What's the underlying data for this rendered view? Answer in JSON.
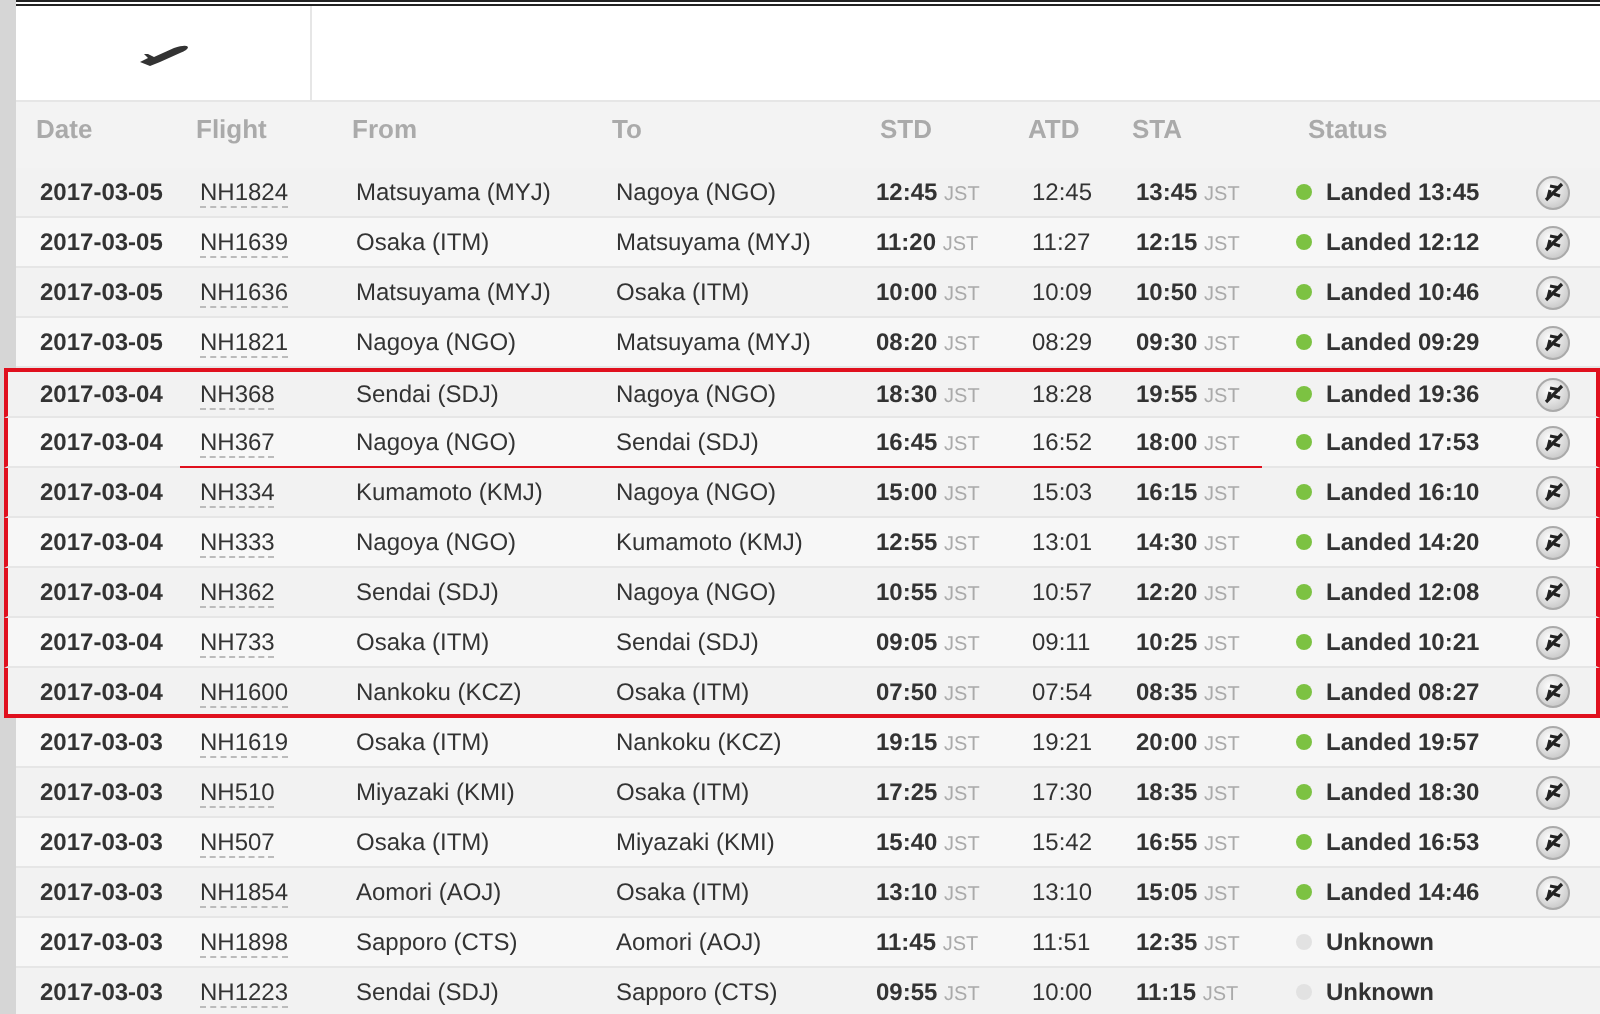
{
  "columns": [
    "Date",
    "Flight",
    "From",
    "To",
    "STD",
    "ATD",
    "STA",
    "Status"
  ],
  "rows": [
    {
      "date": "2017-03-05",
      "flight": "NH1824",
      "from": "Matsuyama (MYJ)",
      "to": "Nagoya (NGO)",
      "std": "12:45",
      "std_tz": "JST",
      "atd": "12:45",
      "sta": "13:45",
      "sta_tz": "JST",
      "status": "Landed 13:45",
      "color": "#7cc242",
      "tracking": true,
      "highlighted": false,
      "underlined": false
    },
    {
      "date": "2017-03-05",
      "flight": "NH1639",
      "from": "Osaka (ITM)",
      "to": "Matsuyama (MYJ)",
      "std": "11:20",
      "std_tz": "JST",
      "atd": "11:27",
      "sta": "12:15",
      "sta_tz": "JST",
      "status": "Landed 12:12",
      "color": "#7cc242",
      "tracking": true,
      "highlighted": false,
      "underlined": false
    },
    {
      "date": "2017-03-05",
      "flight": "NH1636",
      "from": "Matsuyama (MYJ)",
      "to": "Osaka (ITM)",
      "std": "10:00",
      "std_tz": "JST",
      "atd": "10:09",
      "sta": "10:50",
      "sta_tz": "JST",
      "status": "Landed 10:46",
      "color": "#7cc242",
      "tracking": true,
      "highlighted": false,
      "underlined": false
    },
    {
      "date": "2017-03-05",
      "flight": "NH1821",
      "from": "Nagoya (NGO)",
      "to": "Matsuyama (MYJ)",
      "std": "08:20",
      "std_tz": "JST",
      "atd": "08:29",
      "sta": "09:30",
      "sta_tz": "JST",
      "status": "Landed 09:29",
      "color": "#7cc242",
      "tracking": true,
      "highlighted": false,
      "underlined": false
    },
    {
      "date": "2017-03-04",
      "flight": "NH368",
      "from": "Sendai (SDJ)",
      "to": "Nagoya (NGO)",
      "std": "18:30",
      "std_tz": "JST",
      "atd": "18:28",
      "sta": "19:55",
      "sta_tz": "JST",
      "status": "Landed 19:36",
      "color": "#7cc242",
      "tracking": true,
      "highlighted": true,
      "underlined": false
    },
    {
      "date": "2017-03-04",
      "flight": "NH367",
      "from": "Nagoya (NGO)",
      "to": "Sendai (SDJ)",
      "std": "16:45",
      "std_tz": "JST",
      "atd": "16:52",
      "sta": "18:00",
      "sta_tz": "JST",
      "status": "Landed 17:53",
      "color": "#7cc242",
      "tracking": true,
      "highlighted": true,
      "underlined": true
    },
    {
      "date": "2017-03-04",
      "flight": "NH334",
      "from": "Kumamoto (KMJ)",
      "to": "Nagoya (NGO)",
      "std": "15:00",
      "std_tz": "JST",
      "atd": "15:03",
      "sta": "16:15",
      "sta_tz": "JST",
      "status": "Landed 16:10",
      "color": "#7cc242",
      "tracking": true,
      "highlighted": true,
      "underlined": false
    },
    {
      "date": "2017-03-04",
      "flight": "NH333",
      "from": "Nagoya (NGO)",
      "to": "Kumamoto (KMJ)",
      "std": "12:55",
      "std_tz": "JST",
      "atd": "13:01",
      "sta": "14:30",
      "sta_tz": "JST",
      "status": "Landed 14:20",
      "color": "#7cc242",
      "tracking": true,
      "highlighted": true,
      "underlined": false
    },
    {
      "date": "2017-03-04",
      "flight": "NH362",
      "from": "Sendai (SDJ)",
      "to": "Nagoya (NGO)",
      "std": "10:55",
      "std_tz": "JST",
      "atd": "10:57",
      "sta": "12:20",
      "sta_tz": "JST",
      "status": "Landed 12:08",
      "color": "#7cc242",
      "tracking": true,
      "highlighted": true,
      "underlined": false
    },
    {
      "date": "2017-03-04",
      "flight": "NH733",
      "from": "Osaka (ITM)",
      "to": "Sendai (SDJ)",
      "std": "09:05",
      "std_tz": "JST",
      "atd": "09:11",
      "sta": "10:25",
      "sta_tz": "JST",
      "status": "Landed 10:21",
      "color": "#7cc242",
      "tracking": true,
      "highlighted": true,
      "underlined": false
    },
    {
      "date": "2017-03-04",
      "flight": "NH1600",
      "from": "Nankoku (KCZ)",
      "to": "Osaka (ITM)",
      "std": "07:50",
      "std_tz": "JST",
      "atd": "07:54",
      "sta": "08:35",
      "sta_tz": "JST",
      "status": "Landed 08:27",
      "color": "#7cc242",
      "tracking": true,
      "highlighted": true,
      "underlined": false
    },
    {
      "date": "2017-03-03",
      "flight": "NH1619",
      "from": "Osaka (ITM)",
      "to": "Nankoku (KCZ)",
      "std": "19:15",
      "std_tz": "JST",
      "atd": "19:21",
      "sta": "20:00",
      "sta_tz": "JST",
      "status": "Landed 19:57",
      "color": "#7cc242",
      "tracking": true,
      "highlighted": false,
      "underlined": false
    },
    {
      "date": "2017-03-03",
      "flight": "NH510",
      "from": "Miyazaki (KMI)",
      "to": "Osaka (ITM)",
      "std": "17:25",
      "std_tz": "JST",
      "atd": "17:30",
      "sta": "18:35",
      "sta_tz": "JST",
      "status": "Landed 18:30",
      "color": "#7cc242",
      "tracking": true,
      "highlighted": false,
      "underlined": false
    },
    {
      "date": "2017-03-03",
      "flight": "NH507",
      "from": "Osaka (ITM)",
      "to": "Miyazaki (KMI)",
      "std": "15:40",
      "std_tz": "JST",
      "atd": "15:42",
      "sta": "16:55",
      "sta_tz": "JST",
      "status": "Landed 16:53",
      "color": "#7cc242",
      "tracking": true,
      "highlighted": false,
      "underlined": false
    },
    {
      "date": "2017-03-03",
      "flight": "NH1854",
      "from": "Aomori (AOJ)",
      "to": "Osaka (ITM)",
      "std": "13:10",
      "std_tz": "JST",
      "atd": "13:10",
      "sta": "15:05",
      "sta_tz": "JST",
      "status": "Landed 14:46",
      "color": "#7cc242",
      "tracking": true,
      "highlighted": false,
      "underlined": false
    },
    {
      "date": "2017-03-03",
      "flight": "NH1898",
      "from": "Sapporo (CTS)",
      "to": "Aomori (AOJ)",
      "std": "11:45",
      "std_tz": "JST",
      "atd": "11:51",
      "sta": "12:35",
      "sta_tz": "JST",
      "status": "Unknown",
      "color": "#e2e2e2",
      "tracking": false,
      "highlighted": false,
      "underlined": false
    },
    {
      "date": "2017-03-03",
      "flight": "NH1223",
      "from": "Sendai (SDJ)",
      "to": "Sapporo (CTS)",
      "std": "09:55",
      "std_tz": "JST",
      "atd": "10:00",
      "sta": "11:15",
      "sta_tz": "JST",
      "status": "Unknown",
      "color": "#e2e2e2",
      "tracking": false,
      "highlighted": false,
      "underlined": false
    }
  ]
}
